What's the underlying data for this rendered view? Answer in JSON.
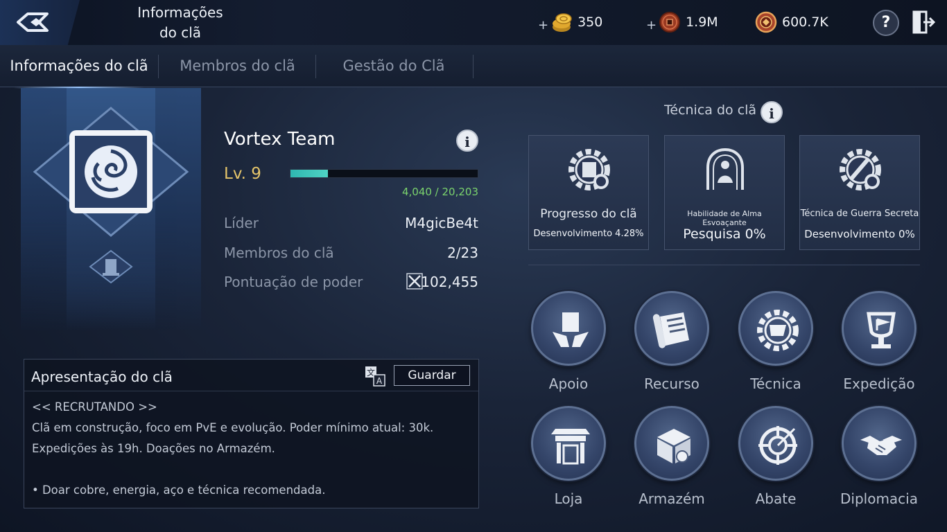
{
  "header": {
    "title_line1": "Informações",
    "title_line2": "do clã",
    "currencies": [
      {
        "icon": "gold-coin-icon",
        "plus": "+",
        "value": "350"
      },
      {
        "icon": "copper-coin-icon",
        "plus": "+",
        "value": "1.9M"
      },
      {
        "icon": "clan-token-icon",
        "value": "600.7K"
      }
    ],
    "help_label": "?"
  },
  "tabs": [
    {
      "label": "Informações do clã",
      "active": true
    },
    {
      "label": "Membros do clã",
      "active": false
    },
    {
      "label": "Gestão do Clã",
      "active": false
    }
  ],
  "clan": {
    "name": "Vortex Team",
    "level": "Lv. 9",
    "xp_text": "4,040 / 20,203",
    "xp_fraction": 0.2,
    "rows": [
      {
        "label": "Líder",
        "value": "M4gicBe4t"
      },
      {
        "label": "Membros do clã",
        "value": "2/23"
      },
      {
        "label": "Pontuação de poder",
        "value": "102,455"
      }
    ]
  },
  "intro": {
    "title": "Apresentação do clã",
    "save_label": "Guardar",
    "lines": [
      "<< RECRUTANDO >>",
      "Clã em construção, foco em PvE e evolução. Poder mínimo atual: 30k.",
      "Expedições às 19h. Doações no Armazém.",
      "",
      "• Doar cobre, energia, aço e técnica recomendada."
    ]
  },
  "tech": {
    "title": "Técnica do clã",
    "cards": [
      {
        "name": "Progresso do clã",
        "value": "Desenvolvimento 4.28%",
        "icon": "clan-progress-gear-icon"
      },
      {
        "name": "Habilidade de Alma Esvoaçante",
        "value": "Pesquisa 0%",
        "icon": "soul-skill-icon"
      },
      {
        "name": "Técnica de Guerra Secreta",
        "value": "Desenvolvimento 0%",
        "icon": "war-technique-gear-icon"
      }
    ]
  },
  "menu": [
    {
      "label": "Apoio",
      "icon": "support-hands-icon"
    },
    {
      "label": "Recurso",
      "icon": "scroll-icon"
    },
    {
      "label": "Técnica",
      "icon": "technique-gear-icon"
    },
    {
      "label": "Expedição",
      "icon": "trophy-icon"
    },
    {
      "label": "Loja",
      "icon": "shop-icon"
    },
    {
      "label": "Armazém",
      "icon": "warehouse-crate-icon"
    },
    {
      "label": "Abate",
      "icon": "target-icon"
    },
    {
      "label": "Diplomacia",
      "icon": "handshake-icon"
    }
  ],
  "colors": {
    "accent_gold": "#e6c56a",
    "xp_green": "#7bd46d",
    "xp_bar": "#2fb7b0"
  }
}
